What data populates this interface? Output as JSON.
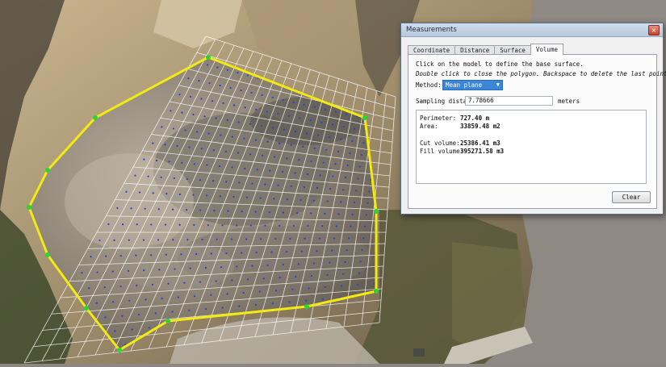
{
  "dialog": {
    "title": "Measurements",
    "close_glyph": "×",
    "tabs": [
      {
        "label": "Coordinate",
        "active": false
      },
      {
        "label": "Distance",
        "active": false
      },
      {
        "label": "Surface",
        "active": false
      },
      {
        "label": "Volume",
        "active": true
      }
    ],
    "instructions": [
      "Click on the model to define the base surface.",
      "Double click to close the polygon. Backspace to delete the last point."
    ],
    "method": {
      "label": "Method:",
      "value": "Mean plane"
    },
    "sampling": {
      "label": "Sampling distance:",
      "value": "7.78666",
      "unit": "meters"
    },
    "results": {
      "perimeter": {
        "label": "Perimeter:",
        "value": "727.40 m"
      },
      "area": {
        "label": "Area:",
        "value": "33859.48 m2"
      },
      "cut_volume": {
        "label": "Cut volume:",
        "value": "25386.41 m3"
      },
      "fill_volume": {
        "label": "Fill volume:",
        "value": "395271.58 m3"
      }
    },
    "clear_label": "Clear"
  },
  "colors": {
    "polygon_edge": "#f2ea12",
    "vertex": "#2ad336",
    "grid": "#ffffff",
    "sample_point": "#2040e0",
    "dialog_select": "#3b86d6"
  },
  "icons": {
    "close": "close-icon",
    "dropdown": "chevron-down-icon"
  }
}
